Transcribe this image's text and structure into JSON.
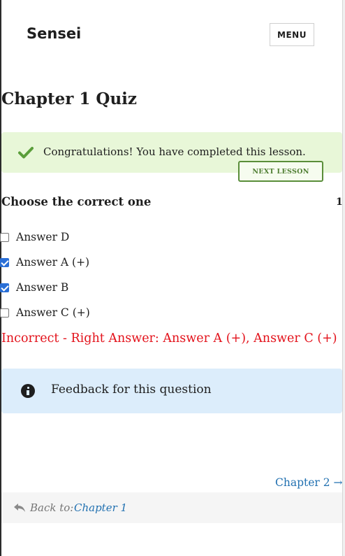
{
  "header": {
    "site_title": "Sensei",
    "menu_label": "MENU"
  },
  "page": {
    "title": "Chapter 1 Quiz"
  },
  "notice": {
    "message": "Congratulations! You have completed this lesson.",
    "next_button": "NEXT LESSON",
    "icon": "checkmark-icon",
    "background": "#e8f7d8",
    "accent": "#5a8e3a"
  },
  "question": {
    "title": "Choose the correct one",
    "grade": "1",
    "answers": [
      {
        "label": "Answer D",
        "checked": false
      },
      {
        "label": "Answer A (+)",
        "checked": true
      },
      {
        "label": "Answer B",
        "checked": true
      },
      {
        "label": "Answer C (+)",
        "checked": false
      }
    ],
    "result": "Incorrect - Right Answer: Answer A (+), Answer C (+)",
    "result_color": "#e3121b"
  },
  "feedback": {
    "text": "Feedback for this question",
    "icon": "info-icon",
    "background": "#dcedfb"
  },
  "navigation": {
    "next_chapter": "Chapter 2 →",
    "back_prefix": "Back to:",
    "back_link": "Chapter 1",
    "back_icon": "reply-arrow-icon",
    "link_color": "#2271b1"
  }
}
